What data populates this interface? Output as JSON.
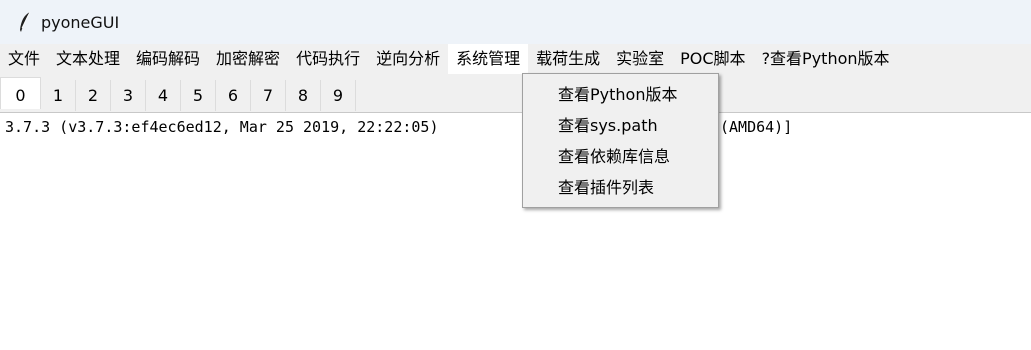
{
  "window": {
    "title": "pyoneGUI",
    "icon": "feather-icon"
  },
  "menubar": {
    "items": [
      "文件",
      "文本处理",
      "编码解码",
      "加密解密",
      "代码执行",
      "逆向分析",
      "系统管理",
      "载荷生成",
      "实验室",
      "POC脚本",
      "?查看Python版本"
    ],
    "active_index": 6
  },
  "tabs": {
    "labels": [
      "0",
      "1",
      "2",
      "3",
      "4",
      "5",
      "6",
      "7",
      "8",
      "9"
    ],
    "selected_index": 0
  },
  "output": {
    "line_left": "3.7.3 (v3.7.3:ef4ec6ed12, Mar 25 2019, 22:22:05)",
    "line_right": "(AMD64)]"
  },
  "dropdown": {
    "parent_menu": "系统管理",
    "items": [
      "查看Python版本",
      "查看sys.path",
      "查看依赖库信息",
      "查看插件列表"
    ]
  },
  "colors": {
    "titlebar_bg": "#eef3f9",
    "chrome_bg": "#f0f0f0",
    "content_bg": "#ffffff"
  }
}
